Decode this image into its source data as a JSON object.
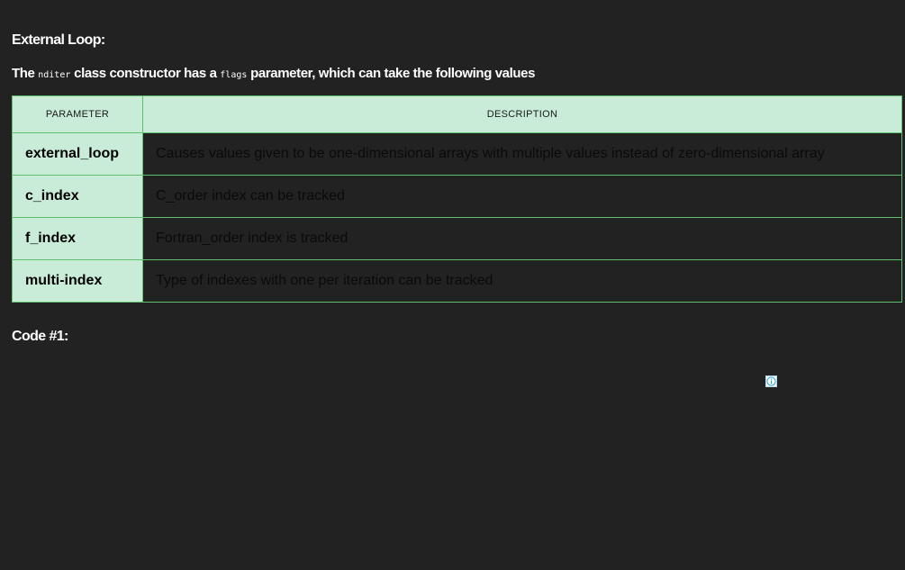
{
  "section": {
    "title": "External Loop:"
  },
  "intro": {
    "text_before": "The ",
    "code1": "nditer",
    "text_middle": " class constructor has a ",
    "code2": "flags",
    "text_after": " parameter, which can take the following values"
  },
  "table": {
    "headers": [
      "PARAMETER",
      "DESCRIPTION"
    ],
    "rows": [
      {
        "param": "external_loop",
        "description": "Causes values given to be one-dimensional arrays with multiple values instead of zero-dimensional array"
      },
      {
        "param": "c_index",
        "description": "C_order index can be tracked"
      },
      {
        "param": "f_index",
        "description": "Fortran_order index is tracked"
      },
      {
        "param": "multi-index",
        "description": "Type of indexes with one per iteration can be tracked"
      }
    ]
  },
  "code_section": {
    "title": "Code #1:"
  },
  "ad": {
    "icon": "info-icon"
  },
  "colors": {
    "page_background": "#222222",
    "table_header_background": "#c8ecd7",
    "table_border": "#5fbf6f"
  }
}
